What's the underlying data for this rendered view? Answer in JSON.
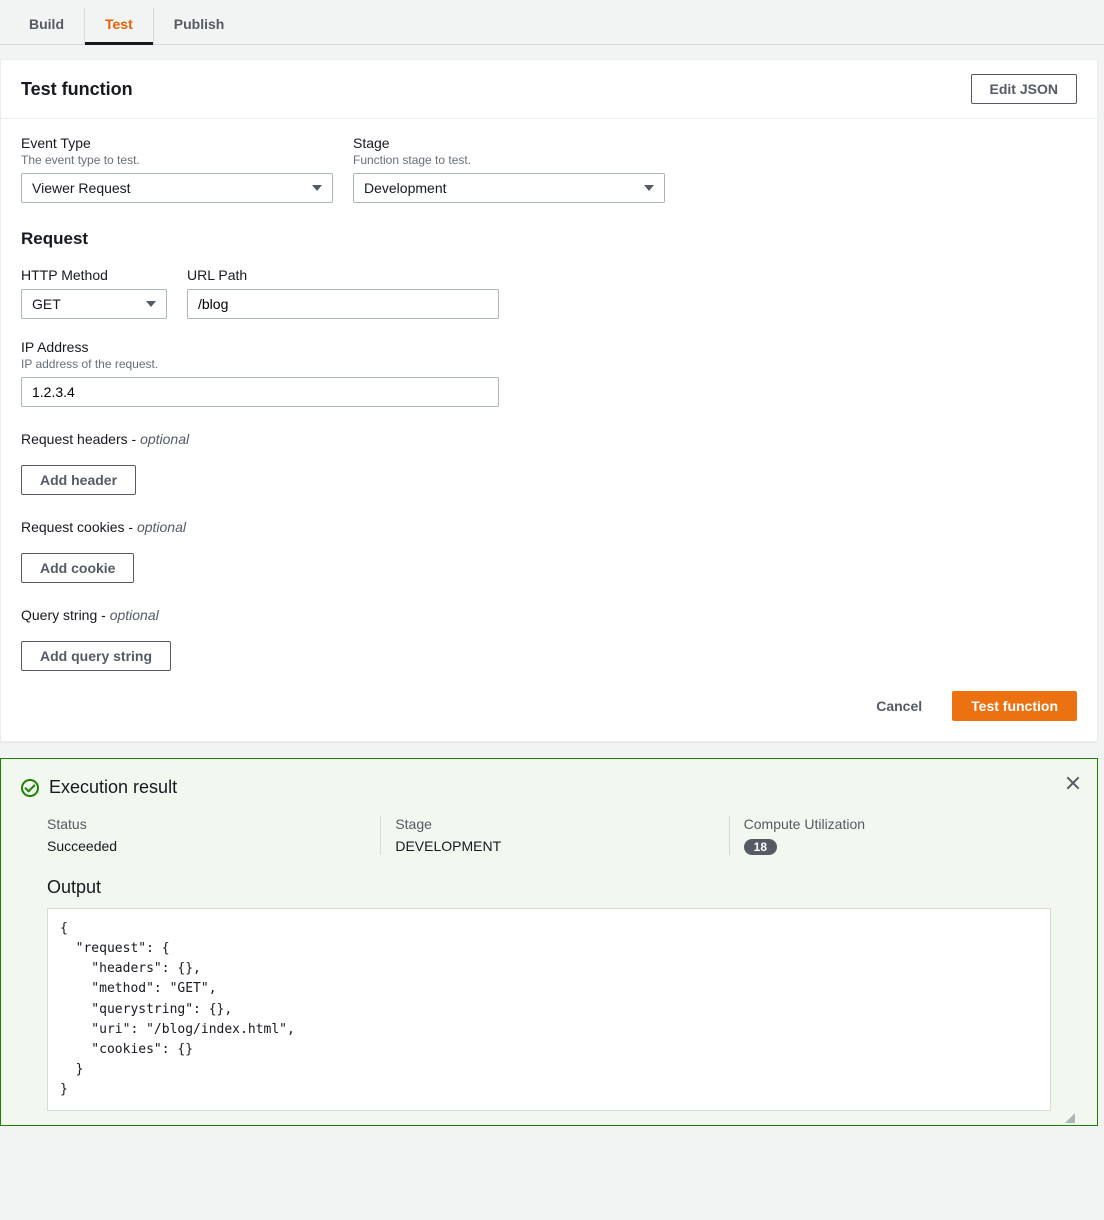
{
  "tabs": {
    "build": "Build",
    "test": "Test",
    "publish": "Publish"
  },
  "panel": {
    "title": "Test function",
    "edit_json": "Edit JSON"
  },
  "event_type": {
    "label": "Event Type",
    "hint": "The event type to test.",
    "value": "Viewer Request"
  },
  "stage": {
    "label": "Stage",
    "hint": "Function stage to test.",
    "value": "Development"
  },
  "request_section": "Request",
  "http_method": {
    "label": "HTTP Method",
    "value": "GET"
  },
  "url_path": {
    "label": "URL Path",
    "value": "/blog"
  },
  "ip": {
    "label": "IP Address",
    "hint": "IP address of the request.",
    "value": "1.2.3.4"
  },
  "headers": {
    "label": "Request headers - ",
    "opt": "optional",
    "button": "Add header"
  },
  "cookies": {
    "label": "Request cookies - ",
    "opt": "optional",
    "button": "Add cookie"
  },
  "query": {
    "label": "Query string - ",
    "opt": "optional",
    "button": "Add query string"
  },
  "actions": {
    "cancel": "Cancel",
    "test": "Test function"
  },
  "result": {
    "title": "Execution result",
    "status_label": "Status",
    "status_value": "Succeeded",
    "stage_label": "Stage",
    "stage_value": "DEVELOPMENT",
    "compute_label": "Compute Utilization",
    "compute_value": "18",
    "output_label": "Output",
    "output_code": "{\n  \"request\": {\n    \"headers\": {},\n    \"method\": \"GET\",\n    \"querystring\": {},\n    \"uri\": \"/blog/index.html\",\n    \"cookies\": {}\n  }\n}"
  }
}
